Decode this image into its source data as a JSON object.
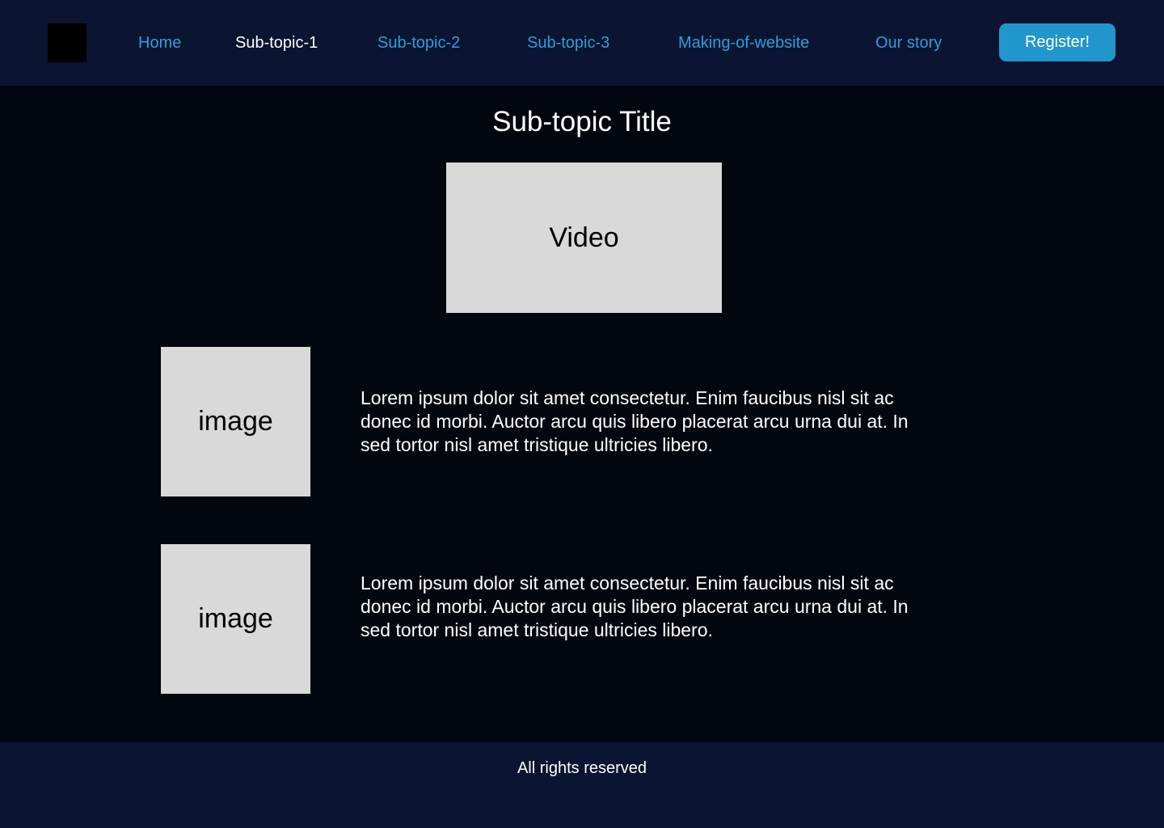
{
  "header": {
    "nav": [
      {
        "label": "Home",
        "active": false
      },
      {
        "label": "Sub-topic-1",
        "active": true
      },
      {
        "label": "Sub-topic-2",
        "active": false
      },
      {
        "label": "Sub-topic-3",
        "active": false
      },
      {
        "label": "Making-of-website",
        "active": false
      },
      {
        "label": "Our story",
        "active": false
      }
    ],
    "register_label": "Register!"
  },
  "main": {
    "title": "Sub-topic Title",
    "video_label": "Video",
    "sections": [
      {
        "image_label": "image",
        "text": "Lorem ipsum dolor sit amet consectetur. Enim faucibus nisl sit ac donec id morbi. Auctor arcu quis libero placerat arcu urna dui at. In sed tortor nisl amet tristique ultricies libero."
      },
      {
        "image_label": "image",
        "text": "Lorem ipsum dolor sit amet consectetur. Enim faucibus nisl sit ac donec id morbi. Auctor arcu quis libero placerat arcu urna dui at. In sed tortor nisl amet tristique ultricies libero."
      }
    ]
  },
  "footer": {
    "text": "All rights reserved"
  },
  "colors": {
    "header_bg": "#0b1430",
    "page_bg": "#02060f",
    "link": "#2d9fd8",
    "active_link": "#ffffff",
    "button": "#2196cc",
    "placeholder": "#d9d9d9"
  }
}
